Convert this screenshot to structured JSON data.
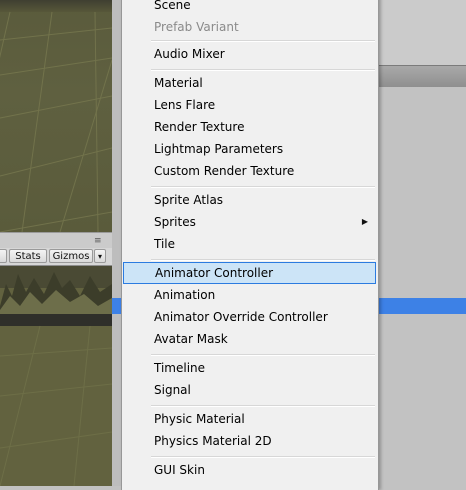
{
  "scene_toolbar": {
    "stats_label": "Stats",
    "gizmos_label": "Gizmos",
    "dropdown_glyph": "▾",
    "menu_glyph": "≡"
  },
  "context_menu": {
    "items": [
      {
        "label": "Scene",
        "enabled": true
      },
      {
        "label": "Prefab Variant",
        "enabled": false
      },
      {
        "label": "Audio Mixer",
        "enabled": true
      },
      {
        "label": "Material",
        "enabled": true
      },
      {
        "label": "Lens Flare",
        "enabled": true
      },
      {
        "label": "Render Texture",
        "enabled": true
      },
      {
        "label": "Lightmap Parameters",
        "enabled": true
      },
      {
        "label": "Custom Render Texture",
        "enabled": true
      },
      {
        "label": "Sprite Atlas",
        "enabled": true
      },
      {
        "label": "Sprites",
        "enabled": true,
        "submenu": true
      },
      {
        "label": "Tile",
        "enabled": true
      },
      {
        "label": "Animator Controller",
        "enabled": true,
        "highlighted": true
      },
      {
        "label": "Animation",
        "enabled": true
      },
      {
        "label": "Animator Override Controller",
        "enabled": true
      },
      {
        "label": "Avatar Mask",
        "enabled": true
      },
      {
        "label": "Timeline",
        "enabled": true
      },
      {
        "label": "Signal",
        "enabled": true
      },
      {
        "label": "Physic Material",
        "enabled": true
      },
      {
        "label": "Physics Material 2D",
        "enabled": true
      },
      {
        "label": "GUI Skin",
        "enabled": true
      }
    ],
    "submenu_glyph": "▶"
  },
  "colors": {
    "highlight_bg": "#cce4f7",
    "highlight_border": "#2b7be0",
    "selection_blue": "#3d81e6",
    "terrain": "#5f6040"
  }
}
